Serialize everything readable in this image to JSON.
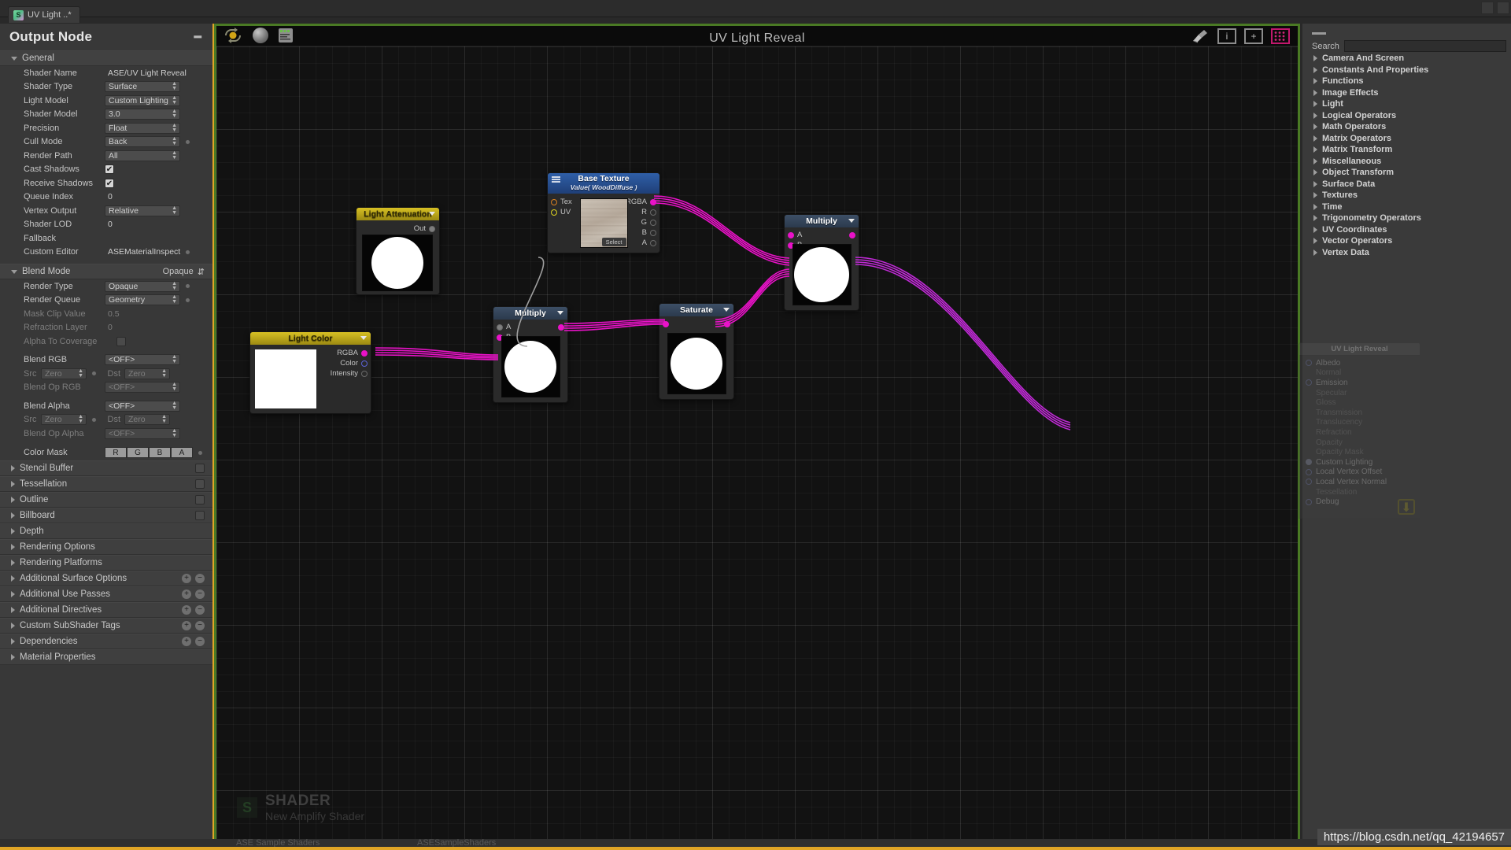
{
  "window": {
    "tab_title": "UV Light ..*",
    "tab_icon": "shader-file-icon"
  },
  "left_panel": {
    "title": "Output Node",
    "collapse_icon": "minus-icon",
    "general": {
      "label": "General",
      "rows": [
        {
          "label": "Shader Name",
          "value": "ASE/UV Light Reveal",
          "kind": "text"
        },
        {
          "label": "Shader Type",
          "value": "Surface",
          "kind": "popup"
        },
        {
          "label": "Light Model",
          "value": "Custom Lighting",
          "kind": "popup"
        },
        {
          "label": "Shader Model",
          "value": "3.0",
          "kind": "popup"
        },
        {
          "label": "Precision",
          "value": "Float",
          "kind": "popup"
        },
        {
          "label": "Cull Mode",
          "value": "Back",
          "kind": "popup-dot"
        },
        {
          "label": "Render Path",
          "value": "All",
          "kind": "popup-dot"
        },
        {
          "label": "Cast Shadows",
          "value": "",
          "kind": "checkbox-on"
        },
        {
          "label": "Receive Shadows",
          "value": "",
          "kind": "checkbox-on"
        },
        {
          "label": "Queue Index",
          "value": "0",
          "kind": "text"
        },
        {
          "label": "Vertex Output",
          "value": "Relative",
          "kind": "popup-dot"
        },
        {
          "label": "Shader LOD",
          "value": "0",
          "kind": "text"
        },
        {
          "label": "Fallback",
          "value": "",
          "kind": "text"
        },
        {
          "label": "Custom Editor",
          "value": "ASEMaterialInspect",
          "kind": "text-dot"
        }
      ]
    },
    "blend_mode": {
      "label": "Blend Mode",
      "header_value": "Opaque",
      "rows": [
        {
          "label": "Render Type",
          "value": "Opaque",
          "kind": "popup-dot"
        },
        {
          "label": "Render Queue",
          "value": "Geometry",
          "kind": "popup-dot"
        },
        {
          "label": "Mask Clip Value",
          "value": "0.5",
          "kind": "text-dim"
        },
        {
          "label": "Refraction Layer",
          "value": "0",
          "kind": "text-dim"
        },
        {
          "label": "Alpha To Coverage",
          "value": "",
          "kind": "checkbox-off-dim"
        }
      ],
      "blend_rgb": {
        "label": "Blend RGB",
        "value": "<OFF>"
      },
      "src_rgb": {
        "src_label": "Src",
        "src_value": "Zero",
        "dst_label": "Dst",
        "dst_value": "Zero"
      },
      "blend_op_rgb": {
        "label": "Blend Op RGB",
        "value": "<OFF>"
      },
      "blend_alpha": {
        "label": "Blend Alpha",
        "value": "<OFF>"
      },
      "src_alpha": {
        "src_label": "Src",
        "src_value": "Zero",
        "dst_label": "Dst",
        "dst_value": "Zero"
      },
      "blend_op_alpha": {
        "label": "Blend Op Alpha",
        "value": "<OFF>"
      },
      "color_mask": {
        "label": "Color Mask",
        "channels": [
          "R",
          "G",
          "B",
          "A"
        ]
      }
    },
    "sections": [
      {
        "label": "Stencil Buffer",
        "has_toggle": true,
        "has_plusminus": false
      },
      {
        "label": "Tessellation",
        "has_toggle": true,
        "has_plusminus": false
      },
      {
        "label": "Outline",
        "has_toggle": true,
        "has_plusminus": false
      },
      {
        "label": "Billboard",
        "has_toggle": true,
        "has_plusminus": false
      },
      {
        "label": "Depth",
        "has_toggle": false,
        "has_plusminus": false
      },
      {
        "label": "Rendering Options",
        "has_toggle": false,
        "has_plusminus": false
      },
      {
        "label": "Rendering Platforms",
        "has_toggle": false,
        "has_plusminus": false
      },
      {
        "label": "Additional Surface Options",
        "has_toggle": false,
        "has_plusminus": true
      },
      {
        "label": "Additional Use Passes",
        "has_toggle": false,
        "has_plusminus": true
      },
      {
        "label": "Additional Directives",
        "has_toggle": false,
        "has_plusminus": true
      },
      {
        "label": "Custom SubShader Tags",
        "has_toggle": false,
        "has_plusminus": true
      },
      {
        "label": "Dependencies",
        "has_toggle": false,
        "has_plusminus": true
      },
      {
        "label": "Material Properties",
        "has_toggle": false,
        "has_plusminus": false
      }
    ]
  },
  "canvas": {
    "title": "UV Light Reveal",
    "toolbar_left": [
      "update-shader-icon",
      "sphere-preview-icon",
      "shader-code-icon"
    ],
    "toolbar_right": [
      "broom-cleanup-icon",
      "info-icon",
      "add-node-icon",
      "grid-toggle-icon"
    ],
    "grid_icon_color": "#c2186d",
    "watermark": {
      "logo": "S",
      "line1": "SHADER",
      "line2": "New Amplify Shader"
    },
    "url_watermark": "https://blog.csdn.net/qq_42194657"
  },
  "nodes": [
    {
      "id": "light-attenuation",
      "title": "Light Attenuation",
      "header_color": "gold",
      "inputs": [],
      "outputs": [
        {
          "label": "Out",
          "state": "gray"
        }
      ]
    },
    {
      "id": "light-color",
      "title": "Light Color",
      "header_color": "gold",
      "inputs": [],
      "outputs": [
        {
          "label": "RGBA",
          "state": "magenta"
        },
        {
          "label": "Color",
          "state": "blue"
        },
        {
          "label": "Intensity",
          "state": "dim"
        }
      ]
    },
    {
      "id": "base-texture",
      "title": "Base Texture",
      "subtitle": "Value( WoodDiffuse )",
      "header_color": "blue",
      "inputs": [
        {
          "label": "Tex",
          "state": "orange"
        },
        {
          "label": "UV",
          "state": "yellow"
        }
      ],
      "outputs": [
        {
          "label": "RGBA",
          "state": "magenta"
        },
        {
          "label": "R",
          "state": "dim"
        },
        {
          "label": "G",
          "state": "dim"
        },
        {
          "label": "B",
          "state": "dim"
        },
        {
          "label": "A",
          "state": "dim"
        }
      ],
      "select_button": "Select"
    },
    {
      "id": "multiply-1",
      "title": "Multiply",
      "header_color": "slate",
      "inputs": [
        {
          "label": "A",
          "state": "gray"
        },
        {
          "label": "B",
          "state": "magenta"
        }
      ],
      "outputs": [
        {
          "label": "",
          "state": "magenta"
        }
      ]
    },
    {
      "id": "saturate",
      "title": "Saturate",
      "header_color": "slate",
      "inputs": [
        {
          "label": "",
          "state": "magenta"
        }
      ],
      "outputs": [
        {
          "label": "",
          "state": "magenta"
        }
      ]
    },
    {
      "id": "multiply-2",
      "title": "Multiply",
      "header_color": "slate",
      "inputs": [
        {
          "label": "A",
          "state": "magenta"
        },
        {
          "label": "B",
          "state": "magenta"
        }
      ],
      "outputs": [
        {
          "label": "",
          "state": "magenta"
        }
      ]
    }
  ],
  "master_node": {
    "title": "UV Light Reveal",
    "ports": [
      {
        "label": "Albedo",
        "active": true
      },
      {
        "label": "Normal",
        "active": false
      },
      {
        "label": "Emission",
        "active": true
      },
      {
        "label": "Specular",
        "active": false
      },
      {
        "label": "Gloss",
        "active": false
      },
      {
        "label": "Transmission",
        "active": false
      },
      {
        "label": "Translucency",
        "active": false
      },
      {
        "label": "Refraction",
        "active": false
      },
      {
        "label": "Opacity",
        "active": false
      },
      {
        "label": "Opacity Mask",
        "active": false
      },
      {
        "label": "Custom Lighting",
        "active": true
      },
      {
        "label": "Local Vertex Offset",
        "active": true
      },
      {
        "label": "Local Vertex Normal",
        "active": true
      },
      {
        "label": "Tessellation",
        "active": false
      },
      {
        "label": "Debug",
        "active": true
      }
    ],
    "download_icon": "download-icon"
  },
  "palette": {
    "search_label": "Search",
    "search_value": "",
    "items": [
      "Camera And Screen",
      "Constants And Properties",
      "Functions",
      "Image Effects",
      "Light",
      "Logical Operators",
      "Math Operators",
      "Matrix Operators",
      "Matrix Transform",
      "Miscellaneous",
      "Object Transform",
      "Surface Data",
      "Textures",
      "Time",
      "Trigonometry Operators",
      "UV Coordinates",
      "Vector Operators",
      "Vertex Data"
    ]
  },
  "bottom_strip": {
    "left_text": "ASESampleShaders",
    "mid_text": "ASE Sample Shaders"
  },
  "colors": {
    "accent_orange": "#e0a526",
    "wire_magenta": "#e912c8",
    "canvas_border_green": "#4a7a24",
    "node_blue": "#2f5fa8",
    "node_gold": "#d7c024"
  }
}
